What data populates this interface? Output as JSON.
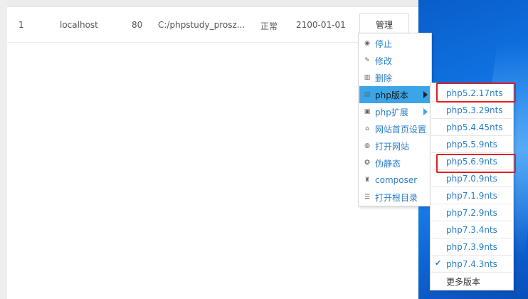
{
  "row": {
    "id": "1",
    "host": "localhost",
    "port": "80",
    "path": "C:/phpstudy_prosz...",
    "status": "正常",
    "expire": "2100-01-01",
    "manage_label": "管理"
  },
  "menu": {
    "items": [
      {
        "label": "停止",
        "icon": "stop-icon"
      },
      {
        "label": "修改",
        "icon": "pencil-icon"
      },
      {
        "label": "删除",
        "icon": "trash-icon"
      },
      {
        "label": "php版本",
        "icon": "file-icon",
        "active": true,
        "submenu": true
      },
      {
        "label": "php扩展",
        "icon": "extension-icon",
        "submenu": true
      },
      {
        "label": "网站首页设置",
        "icon": "home-icon"
      },
      {
        "label": "打开网站",
        "icon": "globe-icon"
      },
      {
        "label": "伪静态",
        "icon": "gear-icon"
      },
      {
        "label": "composer",
        "icon": "composer-icon"
      },
      {
        "label": "打开根目录",
        "icon": "list-icon"
      }
    ]
  },
  "submenu": {
    "items": [
      {
        "label": "php5.2.17nts",
        "highlighted": true
      },
      {
        "label": "php5.3.29nts"
      },
      {
        "label": "php5.4.45nts"
      },
      {
        "label": "php5.5.9nts"
      },
      {
        "label": "php5.6.9nts",
        "highlighted": true
      },
      {
        "label": "php7.0.9nts"
      },
      {
        "label": "php7.1.9nts"
      },
      {
        "label": "php7.2.9nts"
      },
      {
        "label": "php7.3.4nts"
      },
      {
        "label": "php7.3.9nts"
      },
      {
        "label": "php7.4.3nts",
        "checked": true
      },
      {
        "label": "更多版本"
      }
    ]
  },
  "colors": {
    "link": "#2a7ec6",
    "active_bg": "#3ba5e8",
    "highlight_border": "#e02020",
    "desktop": "#0f72e0"
  }
}
